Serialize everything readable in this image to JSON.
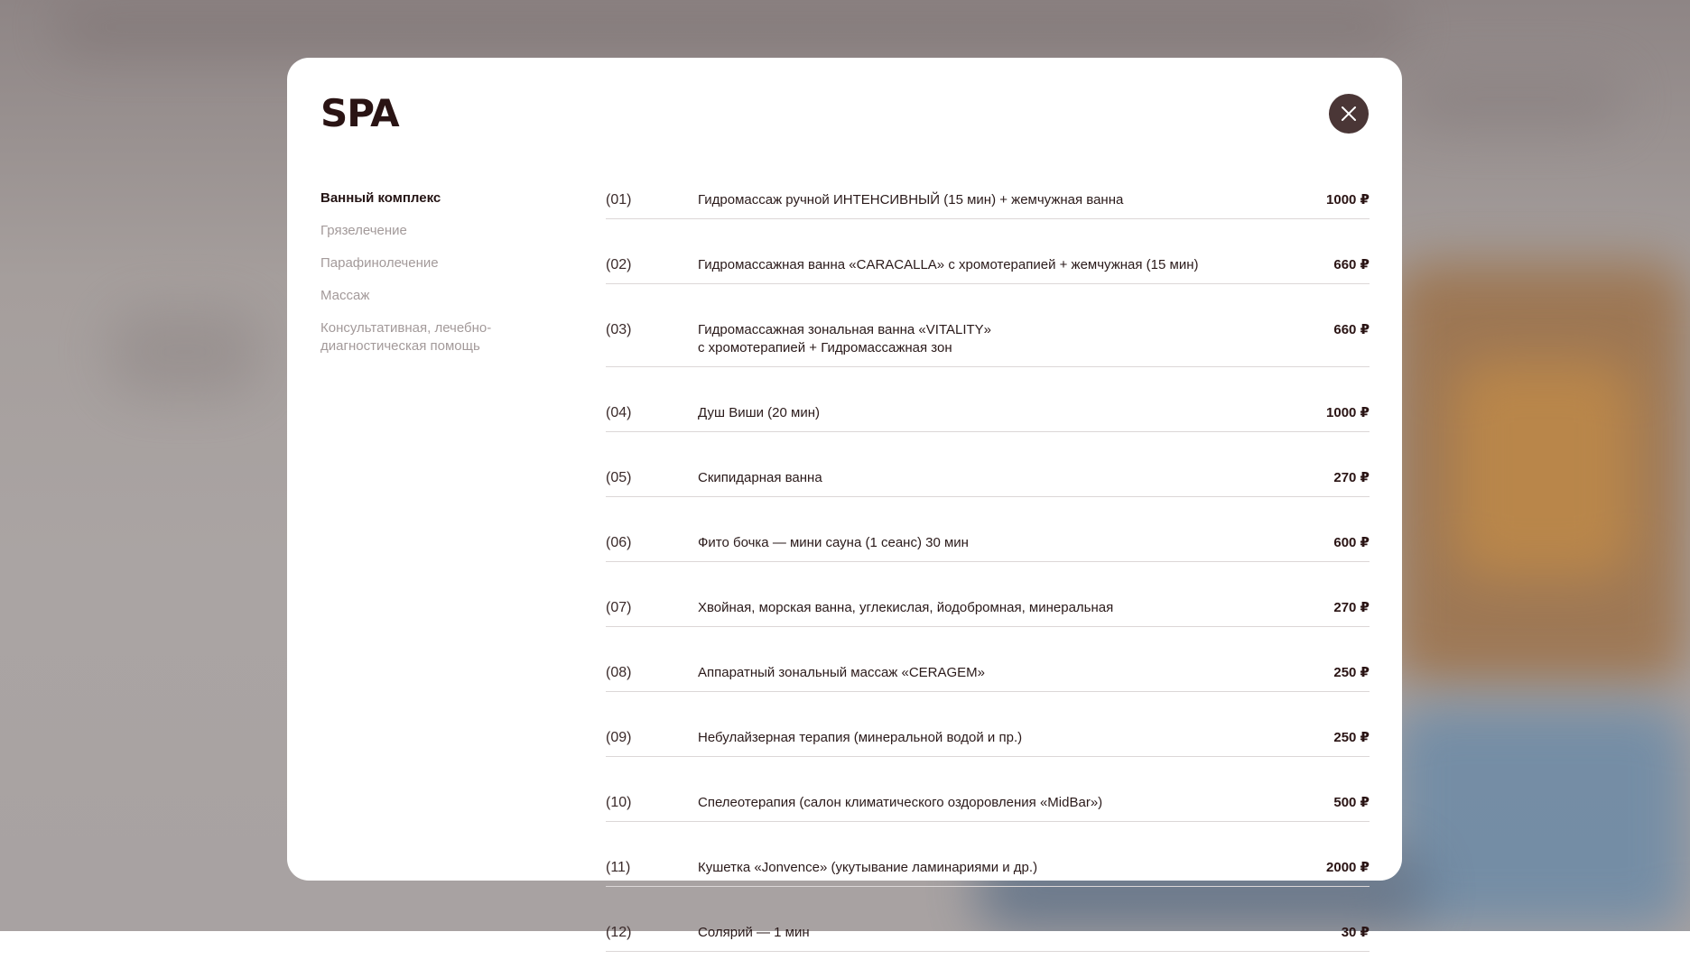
{
  "modal": {
    "title": "SPA",
    "close_icon": "close-icon"
  },
  "sidebar": {
    "items": [
      {
        "label": "Ванный комплекс",
        "active": true
      },
      {
        "label": "Грязелечение",
        "active": false
      },
      {
        "label": "Парафинолечение",
        "active": false
      },
      {
        "label": "Массаж",
        "active": false
      },
      {
        "label": "Консультативная, лечебно-диагностическая помощь",
        "active": false
      }
    ]
  },
  "services": [
    {
      "num": "(01)",
      "name": "Гидромассаж ручной ИНТЕНСИВНЫЙ (15 мин) + жемчужная ванна",
      "price": "1000 ₽"
    },
    {
      "num": "(02)",
      "name": "Гидромассажная ванна «CARACALLA» с хромотерапией + жемчужная (15 мин)",
      "price": "660 ₽"
    },
    {
      "num": "(03)",
      "name": "Гидромассажная зональная ванна «VITALITY» с хромотерапией + Гидромассажная зон",
      "price": "660 ₽"
    },
    {
      "num": "(04)",
      "name": "Душ Виши (20 мин)",
      "price": "1000 ₽"
    },
    {
      "num": "(05)",
      "name": "Скипидарная ванна",
      "price": "270 ₽"
    },
    {
      "num": "(06)",
      "name": "Фито бочка — мини сауна (1 сеанс) 30 мин",
      "price": "600 ₽"
    },
    {
      "num": "(07)",
      "name": "Хвойная, морская ванна, углекислая, йодобромная, минеральная",
      "price": "270 ₽"
    },
    {
      "num": "(08)",
      "name": "Аппаратный зональный массаж «CERAGEM»",
      "price": "250 ₽"
    },
    {
      "num": "(09)",
      "name": "Небулайзерная терапия (минеральной водой и пр.)",
      "price": "250 ₽"
    },
    {
      "num": "(10)",
      "name": "Спелеотерапия (салон климатического оздоровления «MidBar»)",
      "price": "500 ₽"
    },
    {
      "num": "(11)",
      "name": "Кушетка «Jonvence» (укутывание ламинариями и др.)",
      "price": "2000 ₽"
    },
    {
      "num": "(12)",
      "name": "Солярий — 1 мин",
      "price": "30 ₽"
    }
  ]
}
